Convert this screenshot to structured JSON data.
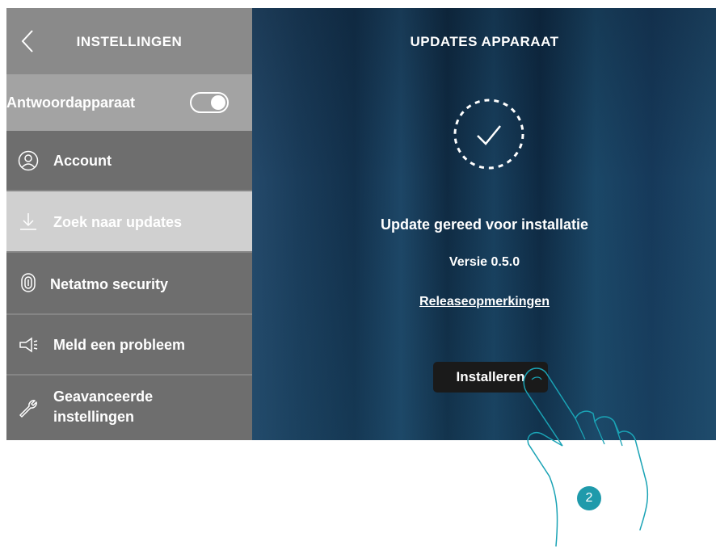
{
  "sidebar": {
    "title": "INSTELLINGEN",
    "toggle": {
      "label": "Antwoordapparaat",
      "state": "on"
    },
    "items": [
      {
        "label": "Account",
        "icon": "user-icon"
      },
      {
        "label": "Zoek naar updates",
        "icon": "download-icon",
        "active": true
      },
      {
        "label": "Netatmo security",
        "icon": "fingerprint-icon"
      },
      {
        "label": "Meld een probleem",
        "icon": "megaphone-icon"
      },
      {
        "label": "Geavanceerde instellingen",
        "icon": "wrench-icon"
      }
    ]
  },
  "main": {
    "title": "UPDATES APPARAAT",
    "status": "Update gereed voor installatie",
    "version": "Versie 0.5.0",
    "release_notes": "Releaseopmerkingen",
    "install_label": "Installeren"
  },
  "annotation": {
    "step": "2"
  },
  "colors": {
    "accent": "#1f9aab",
    "sidebar": "#6f6f6f",
    "sidebar_active": "#d0d0d0",
    "button": "#1a1a1a"
  }
}
